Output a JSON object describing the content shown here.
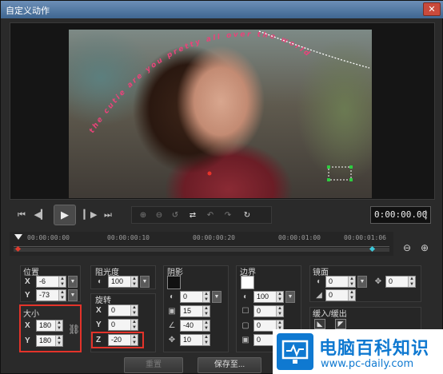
{
  "window": {
    "title": "自定义动作",
    "bg_title_left": "",
    "bg_title_right": ""
  },
  "preview": {
    "overlay_text": "the cutie are you pretty all over the world",
    "accent_colors": {
      "text": "#e8447a",
      "selection": "#2ecc40",
      "dotted_path": "#ffffff"
    }
  },
  "playback": {
    "buttons": [
      "go-to-start",
      "previous-frame",
      "play",
      "next-frame",
      "go-to-end"
    ],
    "timecode": "0:00:00.00"
  },
  "timeline": {
    "ticks": [
      "00:00:00:00",
      "00:00:00:10",
      "00:00:00:20",
      "00:00:01:00",
      "00:00:01:06"
    ]
  },
  "position": {
    "label": "位置",
    "x": "-6",
    "y": "-73"
  },
  "size": {
    "label": "大小",
    "x": "180",
    "y": "180"
  },
  "opacity": {
    "label": "阻光度",
    "value": "100"
  },
  "rotation": {
    "label": "旋转",
    "x": "0",
    "y": "0",
    "z": "-20"
  },
  "shadow": {
    "label": "阴影",
    "color": "#111111",
    "opacity": "0",
    "blur": "15",
    "angle": "-40",
    "distance": "10"
  },
  "border": {
    "label": "边界",
    "color": "#ffffff",
    "opacity": "100",
    "width": "0",
    "blur": "0",
    "offset": "0"
  },
  "mirror": {
    "label": "镜面",
    "opacity": "0",
    "offset": "0",
    "distance": "0"
  },
  "ease": {
    "label": "缓入/缓出"
  },
  "buttons": {
    "reset": "重置",
    "save_as": "保存至..."
  },
  "watermark": {
    "cn": "电脑百科知识",
    "url": "www.pc-daily.com"
  },
  "highlight_color": "#e3332a"
}
